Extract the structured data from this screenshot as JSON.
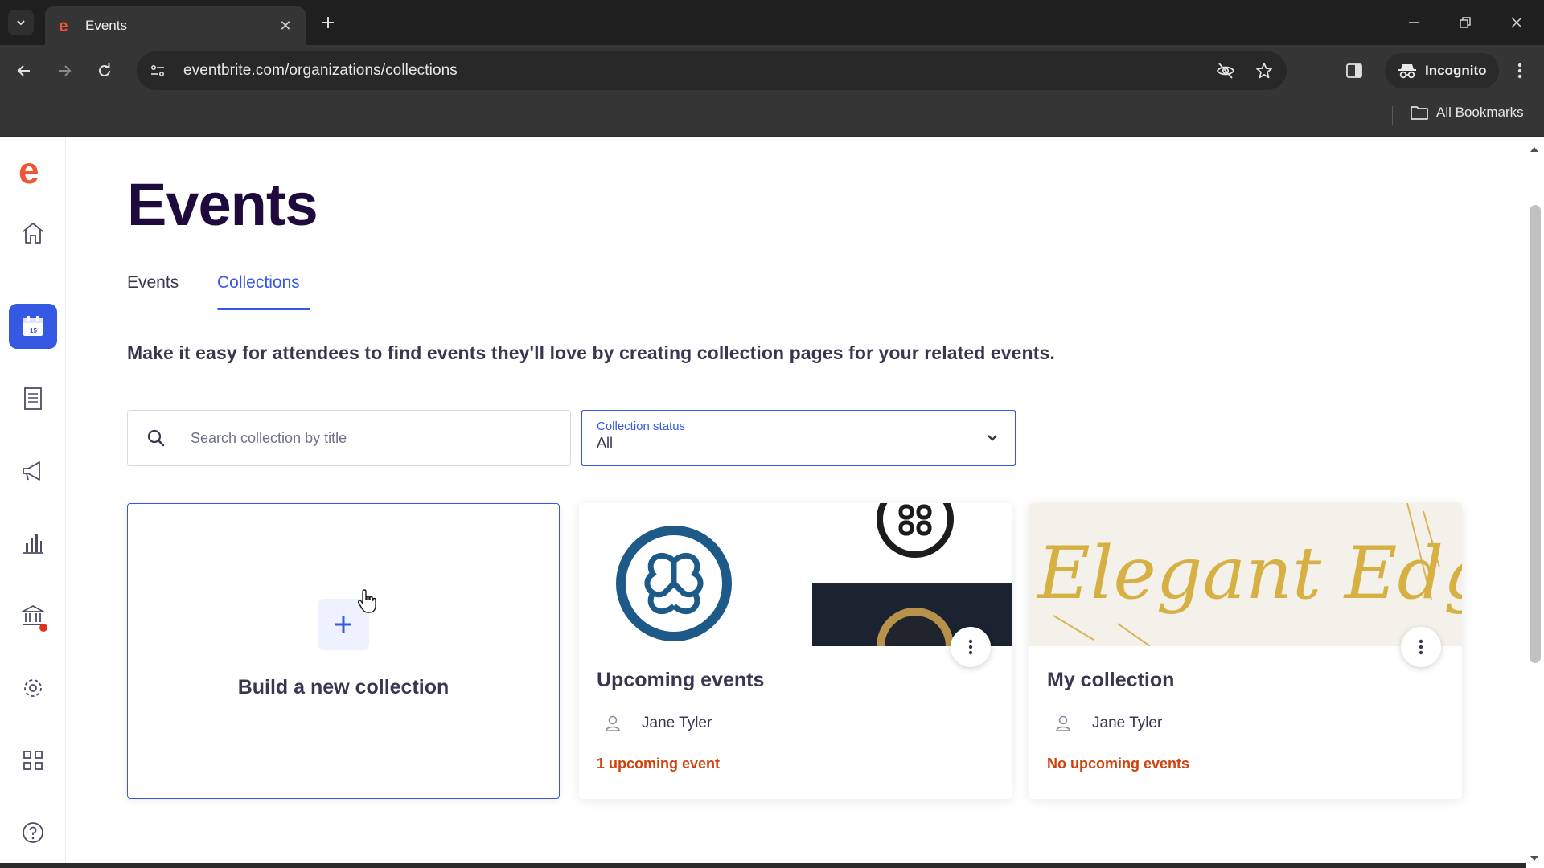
{
  "browser": {
    "tab_title": "Events",
    "url": "eventbrite.com/organizations/collections",
    "incognito_label": "Incognito",
    "bookmarks_label": "All Bookmarks"
  },
  "brand": {
    "accent": "#3659e3",
    "logo_color": "#f05537",
    "heading_color": "#1e0a3c",
    "status_color": "#d1410c"
  },
  "sidebar": {
    "items": [
      {
        "icon": "home-icon",
        "active": false
      },
      {
        "icon": "calendar-icon",
        "active": true
      },
      {
        "icon": "orders-icon",
        "active": false
      },
      {
        "icon": "megaphone-icon",
        "active": false
      },
      {
        "icon": "bar-chart-icon",
        "active": false
      },
      {
        "icon": "finance-bank-icon",
        "active": false,
        "notification": true
      },
      {
        "icon": "gear-icon",
        "active": false
      },
      {
        "icon": "apps-grid-icon",
        "active": false
      },
      {
        "icon": "help-icon",
        "active": false
      }
    ]
  },
  "page": {
    "title": "Events",
    "tabs": [
      {
        "label": "Events",
        "active": false
      },
      {
        "label": "Collections",
        "active": true
      }
    ],
    "description": "Make it easy for attendees to find events they'll love by creating collection pages for your related events."
  },
  "filters": {
    "search_placeholder": "Search collection by title",
    "status_label": "Collection status",
    "status_value": "All"
  },
  "build_card": {
    "label": "Build a new collection"
  },
  "collections": [
    {
      "title": "Upcoming events",
      "owner": "Jane Tyler",
      "status": "1 upcoming event"
    },
    {
      "title": "My collection",
      "owner": "Jane Tyler",
      "status": "No upcoming events"
    }
  ],
  "cover_art": {
    "elegant_edge": "Elegant Edge"
  }
}
